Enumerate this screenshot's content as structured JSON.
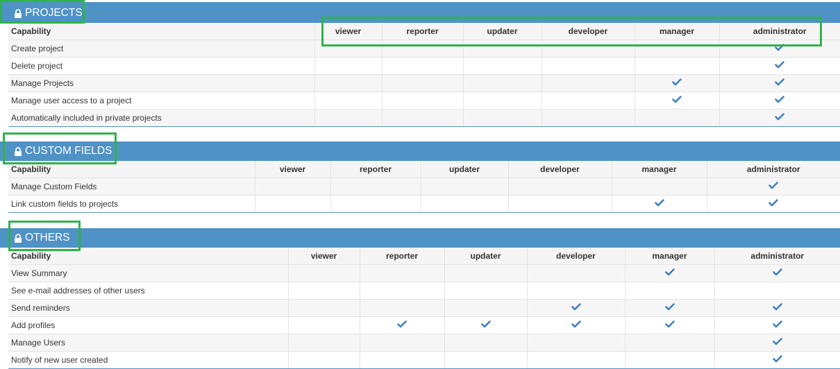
{
  "roles": [
    "viewer",
    "reporter",
    "updater",
    "developer",
    "manager",
    "administrator"
  ],
  "sections": [
    {
      "title": "PROJECTS",
      "capability_header": "Capability",
      "rows": [
        {
          "label": "Create project",
          "checks": [
            false,
            false,
            false,
            false,
            false,
            true
          ]
        },
        {
          "label": "Delete project",
          "checks": [
            false,
            false,
            false,
            false,
            false,
            true
          ]
        },
        {
          "label": "Manage Projects",
          "checks": [
            false,
            false,
            false,
            false,
            true,
            true
          ]
        },
        {
          "label": "Manage user access to a project",
          "checks": [
            false,
            false,
            false,
            false,
            true,
            true
          ]
        },
        {
          "label": "Automatically included in private projects",
          "checks": [
            false,
            false,
            false,
            false,
            false,
            true
          ]
        }
      ]
    },
    {
      "title": "CUSTOM FIELDS",
      "capability_header": "Capability",
      "rows": [
        {
          "label": "Manage Custom Fields",
          "checks": [
            false,
            false,
            false,
            false,
            false,
            true
          ]
        },
        {
          "label": "Link custom fields to projects",
          "checks": [
            false,
            false,
            false,
            false,
            true,
            true
          ]
        }
      ]
    },
    {
      "title": "OTHERS",
      "capability_header": "Capability",
      "rows": [
        {
          "label": "View Summary",
          "checks": [
            false,
            false,
            false,
            false,
            true,
            true
          ]
        },
        {
          "label": "See e-mail addresses of other users",
          "checks": [
            false,
            false,
            false,
            false,
            false,
            false
          ]
        },
        {
          "label": "Send reminders",
          "checks": [
            false,
            false,
            false,
            true,
            true,
            true
          ]
        },
        {
          "label": "Add profiles",
          "checks": [
            false,
            true,
            true,
            true,
            true,
            true
          ]
        },
        {
          "label": "Manage Users",
          "checks": [
            false,
            false,
            false,
            false,
            false,
            true
          ]
        },
        {
          "label": "Notify of new user created",
          "checks": [
            false,
            false,
            false,
            false,
            false,
            true
          ]
        }
      ]
    }
  ],
  "colors": {
    "header_band": "#4f92c6",
    "check": "#3d7fc1",
    "highlight": "#2fb34a"
  },
  "icons": {
    "section_icon": "lock-icon",
    "cell_icon": "checkmark-icon"
  }
}
